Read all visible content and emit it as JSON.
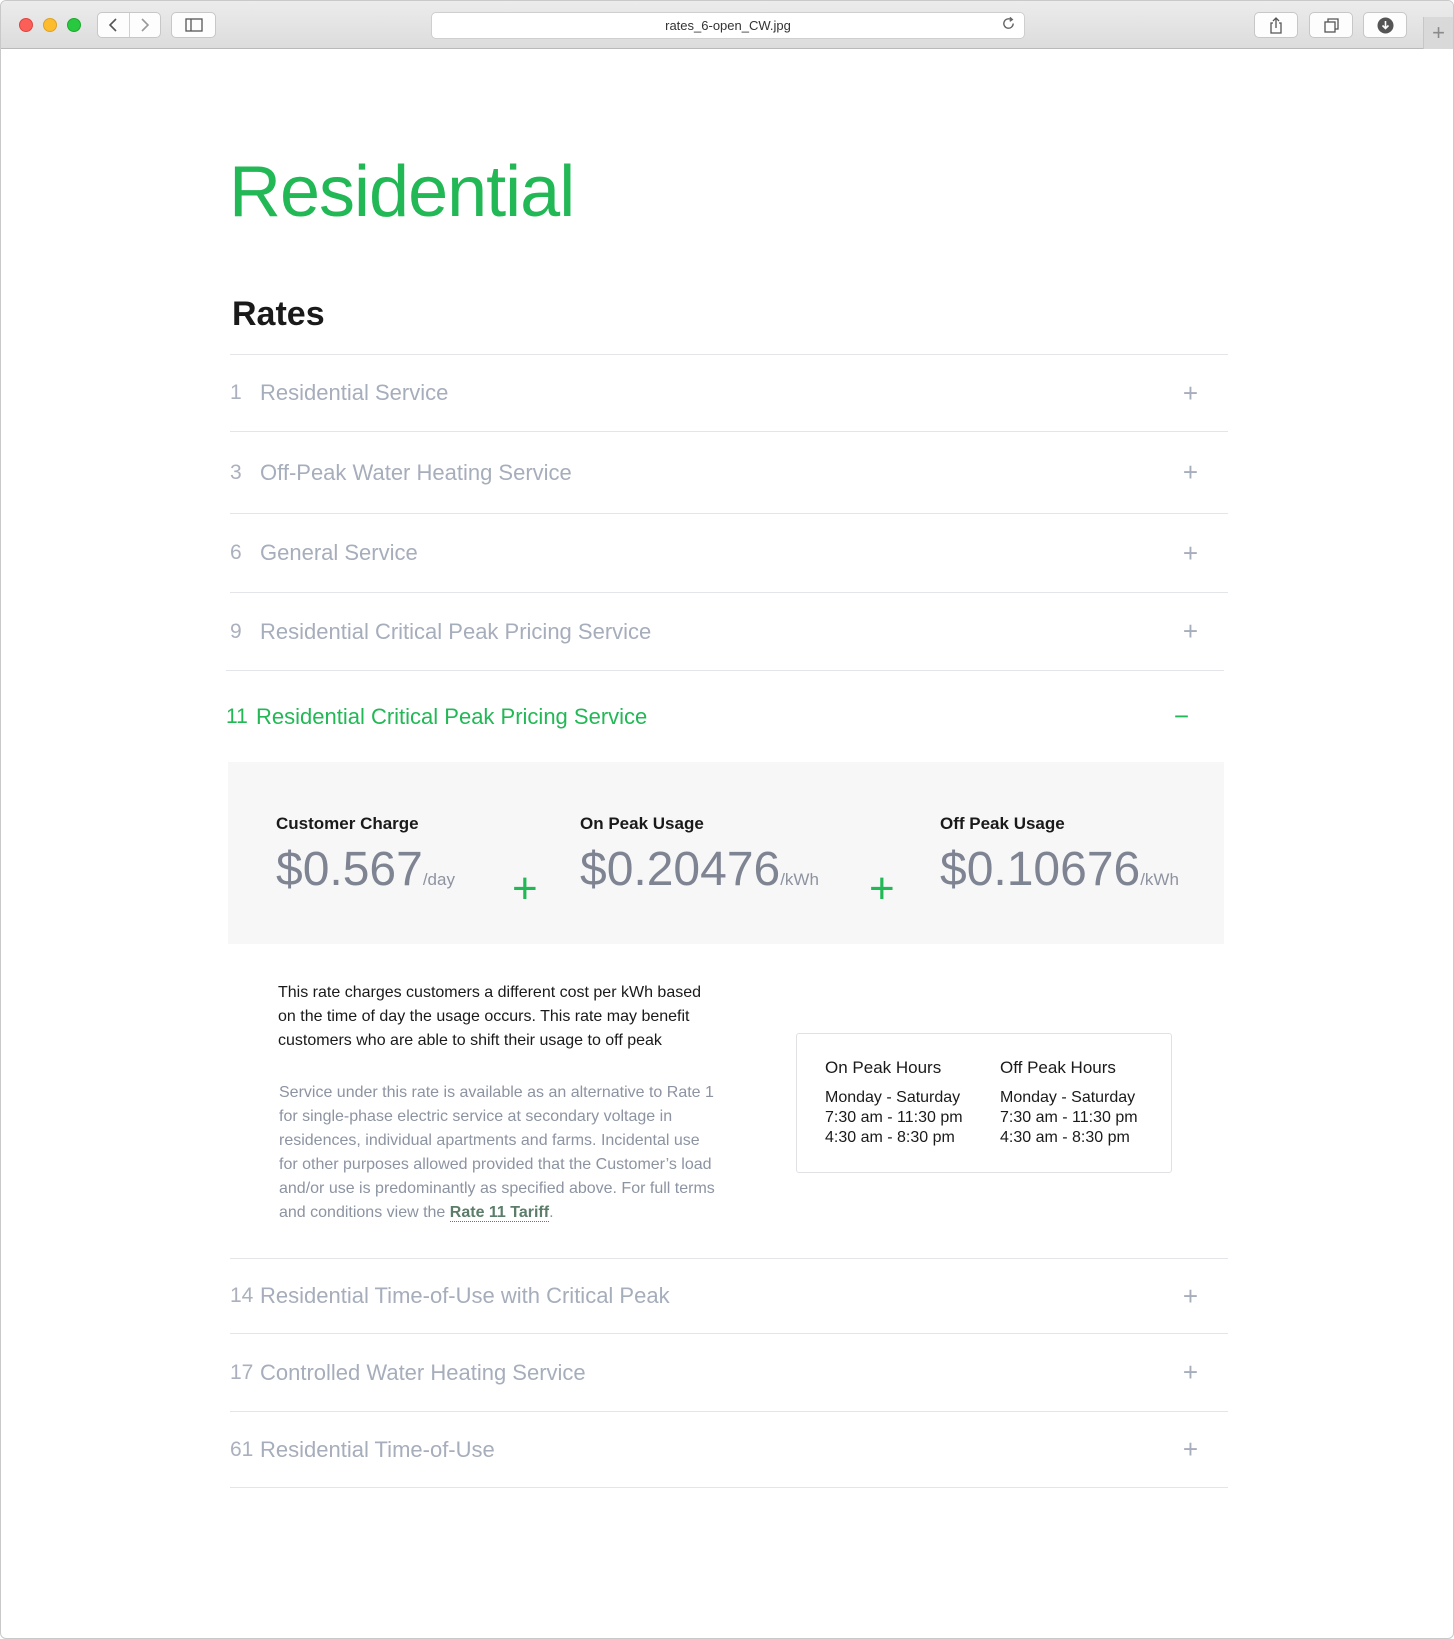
{
  "browser": {
    "url": "rates_6-open_CW.jpg",
    "back_icon": "chevron-left-icon",
    "forward_icon": "chevron-right-icon"
  },
  "page": {
    "title": "Residential",
    "section_title": "Rates"
  },
  "rates": [
    {
      "number": "1",
      "label": "Residential Service",
      "toggle": "+"
    },
    {
      "number": "3",
      "label": "Off-Peak Water Heating Service",
      "toggle": "+"
    },
    {
      "number": "6",
      "label": "General Service",
      "toggle": "+"
    },
    {
      "number": "9",
      "label": "Residential Critical Peak Pricing Service",
      "toggle": "+"
    },
    {
      "number": "11",
      "label": "Residential Critical Peak Pricing Service",
      "toggle": "−",
      "expanded": true
    },
    {
      "number": "14",
      "label": "Residential Time-of-Use with Critical Peak",
      "toggle": "+"
    },
    {
      "number": "17",
      "label": "Controlled Water Heating Service",
      "toggle": "+"
    },
    {
      "number": "61",
      "label": "Residential Time-of-Use",
      "toggle": "+"
    }
  ],
  "expanded": {
    "charges": [
      {
        "label": "Customer Charge",
        "amount": "$0.567",
        "unit": "/day"
      },
      {
        "label": "On Peak Usage",
        "amount": "$0.20476",
        "unit": "/kWh"
      },
      {
        "label": "Off Peak Usage",
        "amount": "$0.10676",
        "unit": "/kWh"
      }
    ],
    "plus_sign": "+",
    "description": "This rate charges customers a different cost per kWh based on the time of day the usage occurs. This rate may benefit customers who are able to shift their usage to off peak",
    "terms_text": "Service under this rate is available as an alternative to Rate 1 for single-phase electric service at secondary voltage in residences, individual apartments and farms. Incidental use for other purposes allowed provided that the Customer’s load and/or use is predominantly as specified above. For full terms and conditions view the ",
    "terms_link": "Rate 11 Tariff",
    "terms_end": ".",
    "hours": {
      "on_peak": {
        "title": "On Peak Hours",
        "days": "Monday - Saturday",
        "range1": "7:30 am - 11:30 pm",
        "range2": "4:30 am - 8:30 pm"
      },
      "off_peak": {
        "title": "Off Peak Hours",
        "days": "Monday - Saturday",
        "range1": "7:30 am - 11:30 pm",
        "range2": "4:30 am - 8:30 pm"
      }
    }
  },
  "colors": {
    "accent": "#22b856",
    "muted": "#a6adbb"
  }
}
